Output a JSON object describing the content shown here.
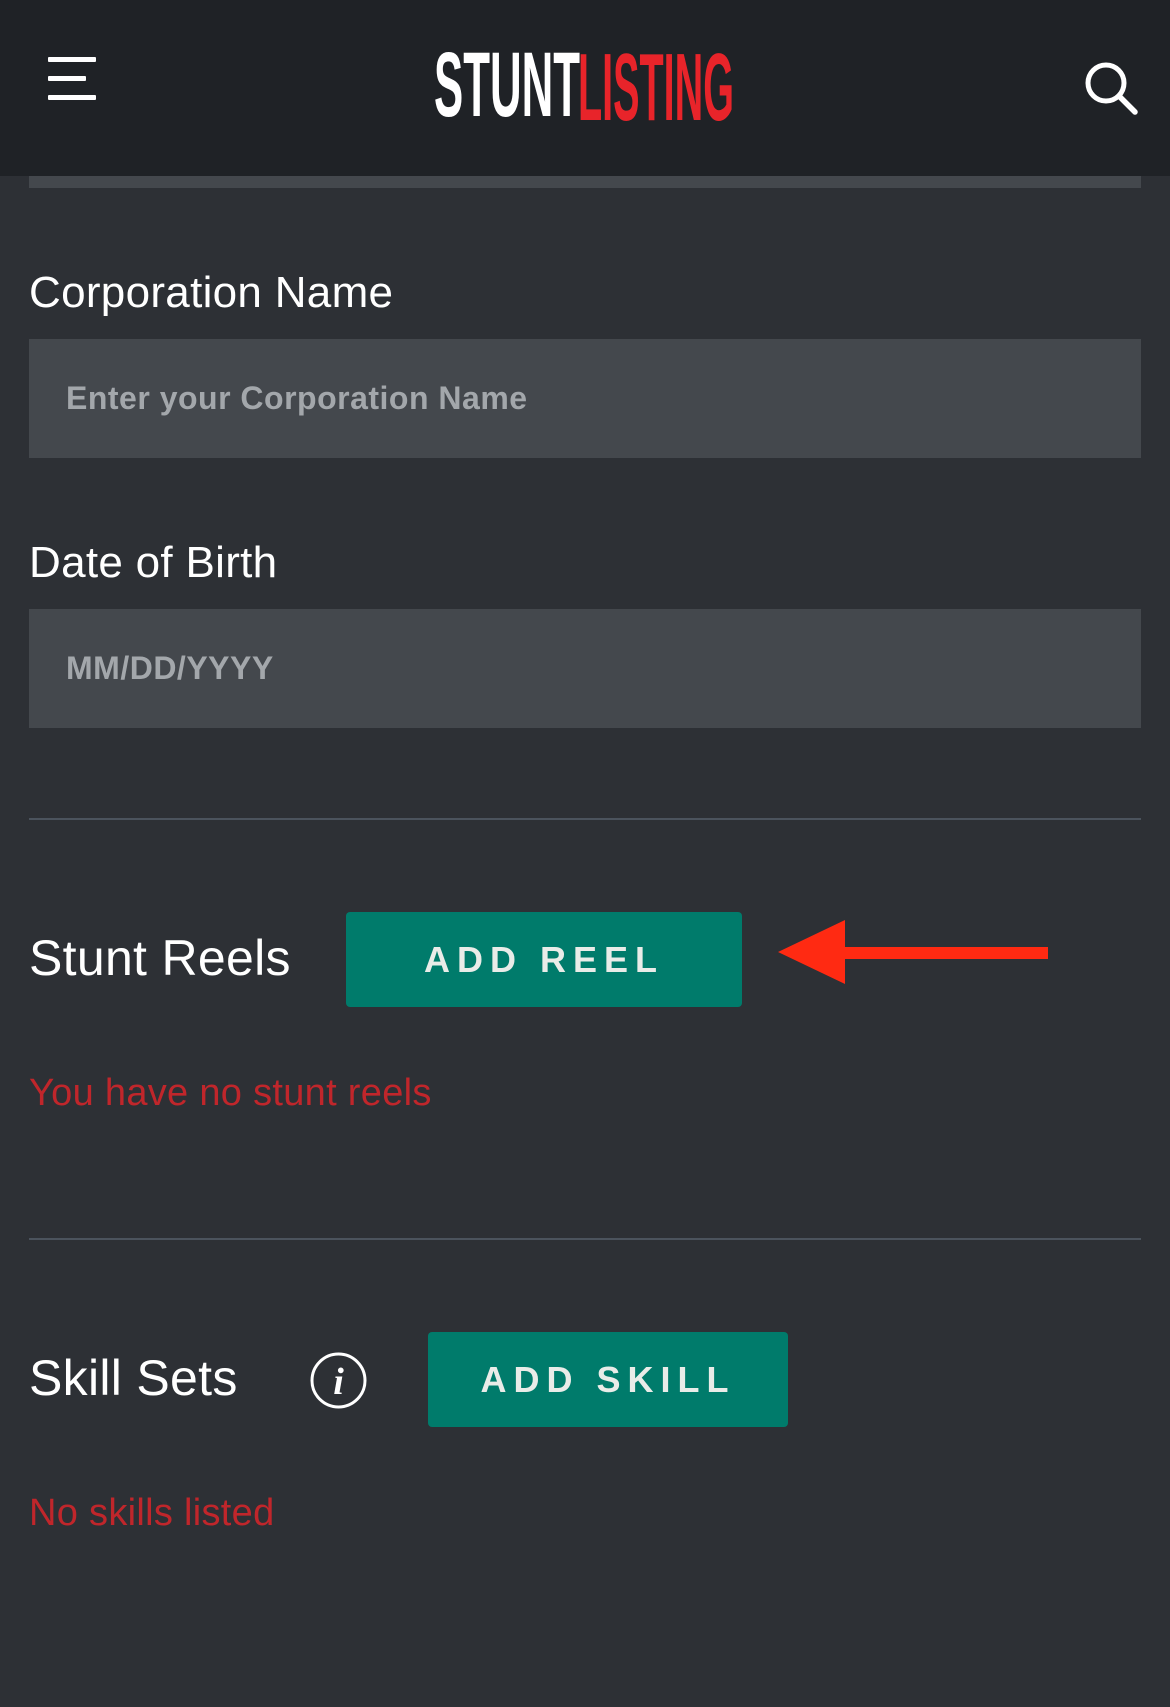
{
  "header": {
    "logo": {
      "part1": "STUNT",
      "part2": "LISTING"
    },
    "menu_icon": "hamburger-menu-icon",
    "search_icon": "search-icon"
  },
  "form": {
    "corporation": {
      "label": "Corporation Name",
      "placeholder": "Enter your Corporation Name"
    },
    "dob": {
      "label": "Date of Birth",
      "placeholder": "MM/DD/YYYY"
    }
  },
  "stunt_reels": {
    "title": "Stunt Reels",
    "button_label": "ADD REEL",
    "empty_message": "You have no stunt reels",
    "annotation_icon": "arrow-left-icon"
  },
  "skill_sets": {
    "title": "Skill Sets",
    "info_icon": "info-icon",
    "button_label": "ADD SKILL",
    "empty_message": "No skills listed"
  },
  "colors": {
    "header_bg": "#1f2226",
    "page_bg": "#2d3035",
    "input_bg": "#44484d",
    "button_bg": "#007b6b",
    "error_text": "#c0262b",
    "logo_red": "#e8242a",
    "arrow_red": "#ff2a12"
  }
}
